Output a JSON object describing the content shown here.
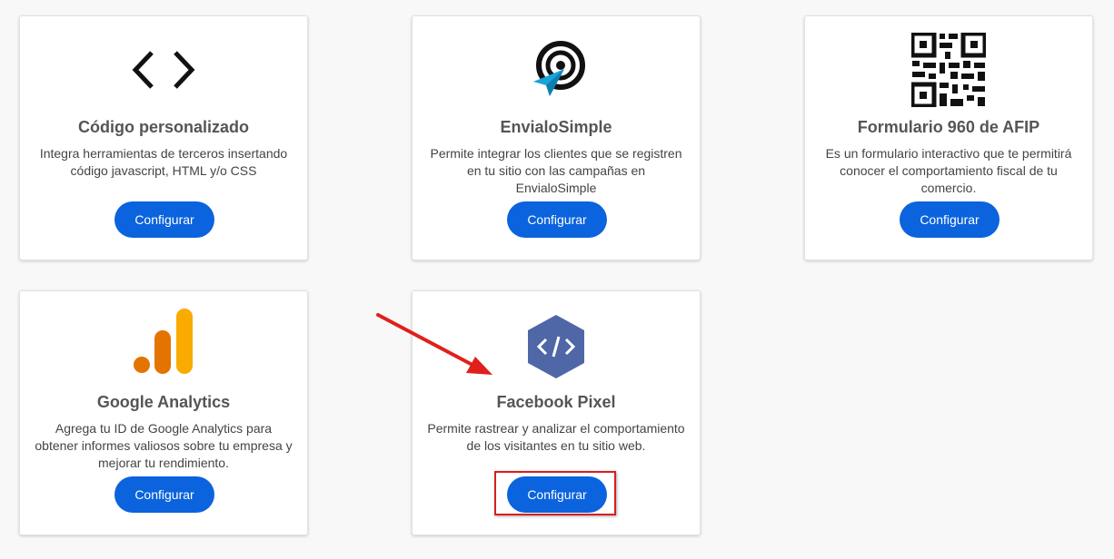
{
  "cards": [
    {
      "title": "Código personalizado",
      "description": "Integra herramientas de terceros insertando código javascript, HTML y/o CSS",
      "button": "Configurar",
      "icon": "code-brackets-icon"
    },
    {
      "title": "EnvialoSimple",
      "description": "Permite integrar los clientes que se registren en tu sitio con las campañas en EnvialoSimple",
      "button": "Configurar",
      "icon": "paper-plane-target-icon"
    },
    {
      "title": "Formulario 960 de AFIP",
      "description": "Es un formulario interactivo que te permitirá conocer el comportamiento fiscal de tu comercio.",
      "button": "Configurar",
      "icon": "qr-code-icon"
    },
    {
      "title": "Google Analytics",
      "description": "Agrega tu ID de Google Analytics para obtener informes valiosos sobre tu empresa y mejorar tu rendimiento.",
      "button": "Configurar",
      "icon": "analytics-bars-icon"
    },
    {
      "title": "Facebook Pixel",
      "description": "Permite rastrear y analizar el comportamiento de los visitantes en tu sitio web.",
      "button": "Configurar",
      "icon": "code-hexagon-icon"
    }
  ],
  "colors": {
    "button": "#0b63de",
    "annotation": "#d81e1e",
    "hexagon": "#4f67a6"
  }
}
